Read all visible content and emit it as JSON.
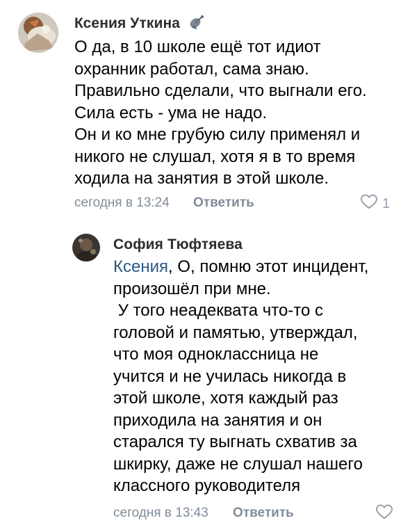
{
  "comments": [
    {
      "author": "Ксения Уткина",
      "lines": [
        "О да, в 10 школе ещё тот идиот",
        "охранник работал, сама знаю.",
        "Правильно сделали, что выгнали его.",
        "Сила есть - ума не надо.",
        "Он и ко мне грубую силу применял и",
        "никого не слушал, хотя я в то время",
        "ходила на занятия в этой школе."
      ],
      "time": "сегодня в 13:24",
      "reply_label": "Ответить",
      "likes": "1"
    },
    {
      "author": "София Тюфтяева",
      "mention": "Ксения",
      "first_line_rest": ", О, помню этот инцидент,",
      "lines": [
        "произошёл при мне.",
        " У того неадеквата что-то с",
        "головой и памятью, утверждал,",
        "что моя одноклассница не",
        "учится и не училась никогда в",
        "этой школе, хотя каждый раз",
        "приходила на занятия и он",
        "старался ту выгнать схватив за",
        "шкирку, даже не слушал нашего",
        "классного руководителя"
      ],
      "time": "сегодня в 13:43",
      "reply_label": "Ответить",
      "likes": ""
    }
  ],
  "colors": {
    "mention": "#2a5885",
    "meta": "#818c99",
    "author": "#2c2d2e"
  }
}
